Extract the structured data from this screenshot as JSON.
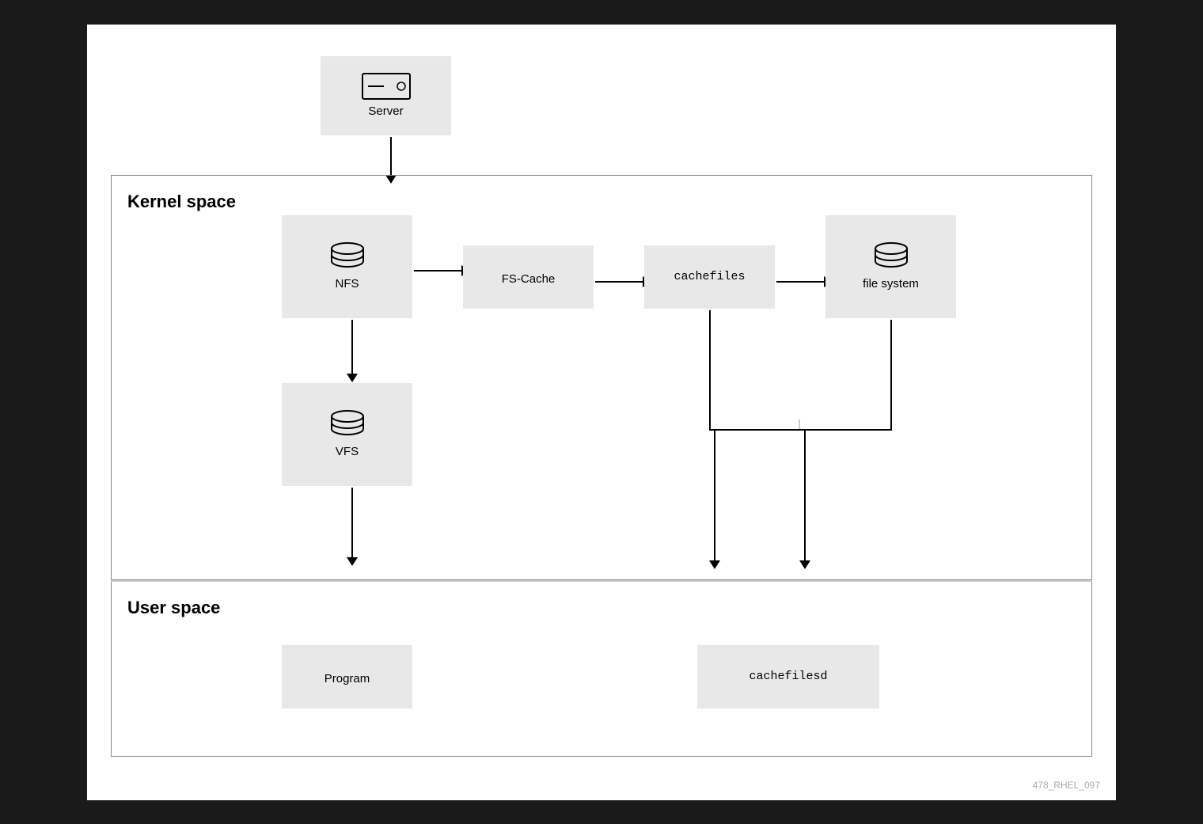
{
  "diagram": {
    "background": "#ffffff",
    "watermark": "478_RHEL_097",
    "sections": {
      "kernel": "Kernel space",
      "user": "User space"
    },
    "nodes": {
      "server": {
        "label": "Server"
      },
      "nfs": {
        "label": "NFS"
      },
      "fscache": {
        "label": "FS-Cache"
      },
      "cachefiles": {
        "label": "cachefiles"
      },
      "filesystem": {
        "label": "file system"
      },
      "vfs": {
        "label": "VFS"
      },
      "program": {
        "label": "Program"
      },
      "cachefilesd": {
        "label": "cachefilesd"
      }
    }
  }
}
